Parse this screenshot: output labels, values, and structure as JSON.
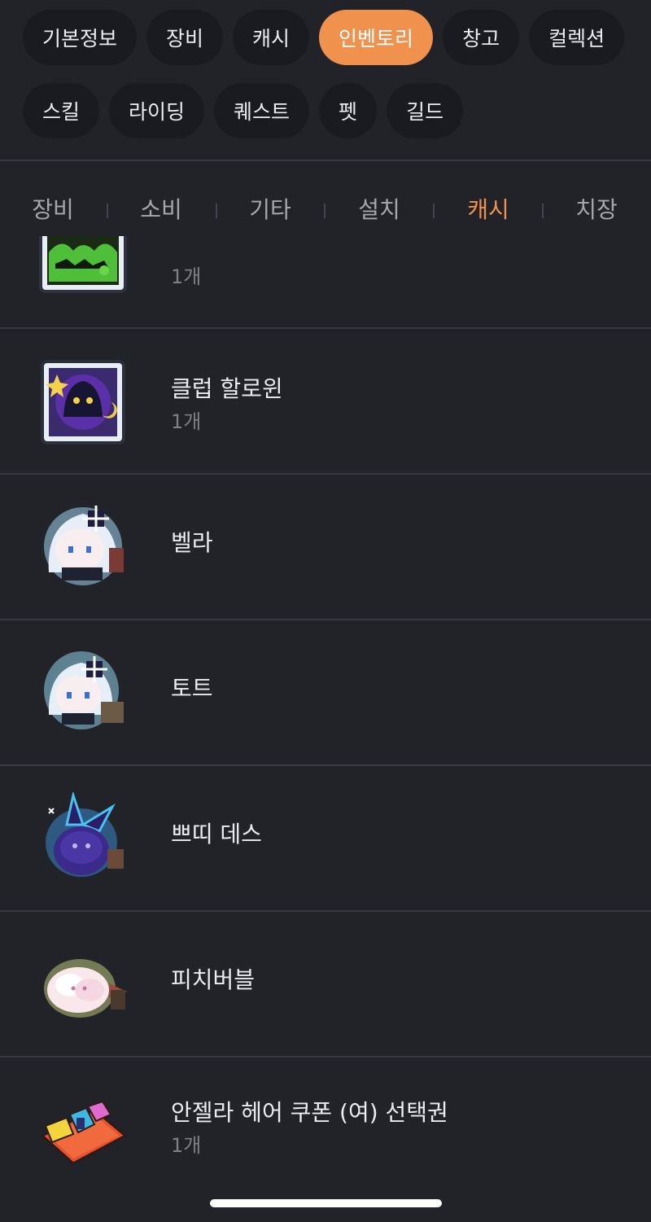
{
  "main_nav": {
    "row1": [
      "기본정보",
      "장비",
      "캐시",
      "인벤토리",
      "창고",
      "컬렉션"
    ],
    "row2": [
      "스킬",
      "라이딩",
      "퀘스트",
      "펫",
      "길드"
    ],
    "active": "인벤토리"
  },
  "sub_tabs": {
    "items": [
      "장비",
      "소비",
      "기타",
      "설치",
      "캐시",
      "치장"
    ],
    "active": "캐시"
  },
  "items": [
    {
      "name": "",
      "count": "1개",
      "icon": "green-bat-cube-icon"
    },
    {
      "name": "클럽 할로윈",
      "count": "1개",
      "icon": "halloween-ghost-box-icon"
    },
    {
      "name": "벨라",
      "count": "",
      "icon": "bella-pet-icon"
    },
    {
      "name": "토트",
      "count": "",
      "icon": "tote-pet-icon"
    },
    {
      "name": "쁘띠 데스",
      "count": "",
      "icon": "petit-death-pet-icon"
    },
    {
      "name": "피치버블",
      "count": "",
      "icon": "peach-bubble-pet-icon"
    },
    {
      "name": "안젤라 헤어 쿠폰 (여) 선택권",
      "count": "1개",
      "icon": "hair-coupon-icon"
    }
  ],
  "colors": {
    "background": "#222329",
    "accent": "#f0924e",
    "pill_bg": "#1a1b20",
    "divider": "#383a41"
  }
}
